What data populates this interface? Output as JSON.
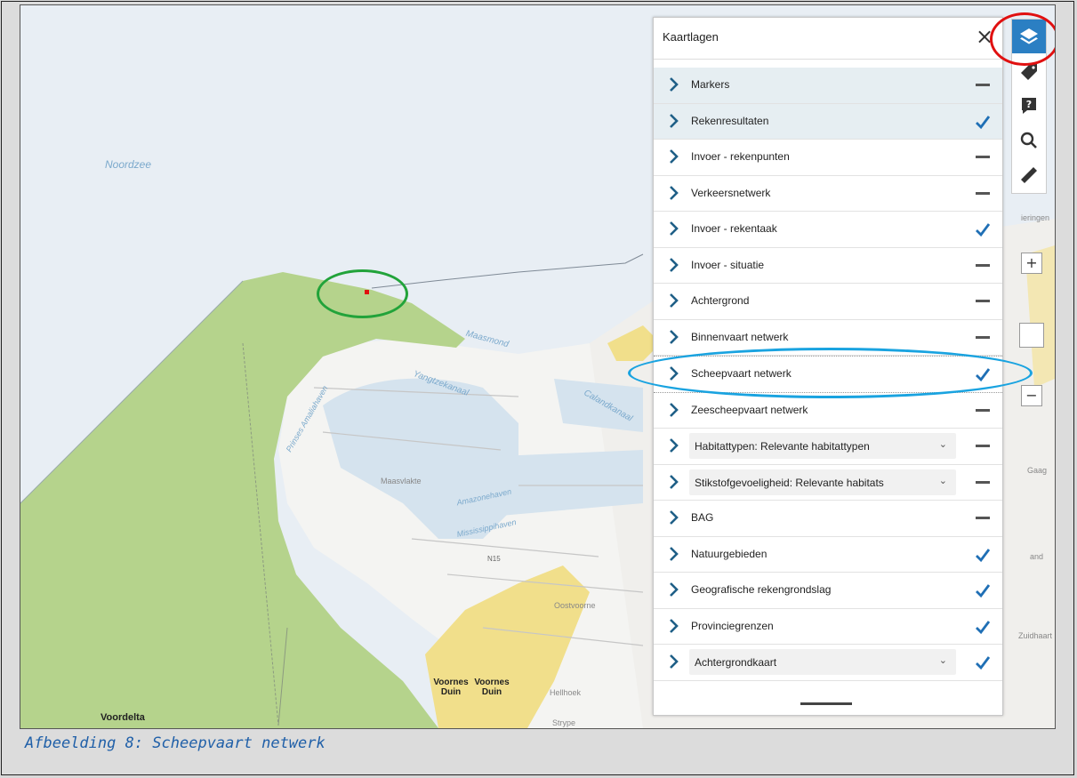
{
  "caption": "Afbeelding 8: Scheepvaart netwerk",
  "map": {
    "labels": {
      "noordzee": "Noordzee",
      "maasmond": "Maasmond",
      "yangtzekanaal": "Yangtzekanaal",
      "calandkanaal": "Calandkanaal",
      "prinses_amaliahaven": "Prinses Amaliahaven",
      "maasvlakte": "Maasvlakte",
      "amazonehaven": "Amazonehaven",
      "mississippihaven": "Mississippihaven",
      "n15": "N15",
      "oostvoorne": "Oostvoorne",
      "voornes_duin_1": "Voornes Duin",
      "voornes_duin_2": "Voornes Duin",
      "hellhoek": "Hellhoek",
      "voordelta": "Voordelta",
      "vierlingen": "ieringen",
      "gaag": "Gaag",
      "and": "and",
      "zuidhaert": "Zuidhaart",
      "strype": "Strype"
    }
  },
  "panel": {
    "title": "Kaartlagen",
    "close_symbol": "×",
    "layers": [
      {
        "label": "Markers",
        "state": "dash",
        "highlight": true,
        "dropdown": false
      },
      {
        "label": "Rekenresultaten",
        "state": "check",
        "highlight": true,
        "dropdown": false
      },
      {
        "label": "Invoer - rekenpunten",
        "state": "dash",
        "highlight": false,
        "dropdown": false
      },
      {
        "label": "Verkeersnetwerk",
        "state": "dash",
        "highlight": false,
        "dropdown": false
      },
      {
        "label": "Invoer - rekentaak",
        "state": "check",
        "highlight": false,
        "dropdown": false
      },
      {
        "label": "Invoer - situatie",
        "state": "dash",
        "highlight": false,
        "dropdown": false
      },
      {
        "label": "Achtergrond",
        "state": "dash",
        "highlight": false,
        "dropdown": false
      },
      {
        "label": "Binnenvaart netwerk",
        "state": "dash",
        "highlight": false,
        "dropdown": false
      },
      {
        "label": "Scheepvaart netwerk",
        "state": "check",
        "highlight": false,
        "dropdown": false
      },
      {
        "label": "Zeescheepvaart netwerk",
        "state": "dash",
        "highlight": false,
        "dropdown": false
      },
      {
        "label": "Habitattypen: Relevante habitattypen",
        "state": "dash",
        "highlight": false,
        "dropdown": true
      },
      {
        "label": "Stikstofgevoeligheid: Relevante habitats",
        "state": "dash",
        "highlight": false,
        "dropdown": true
      },
      {
        "label": "BAG",
        "state": "dash",
        "highlight": false,
        "dropdown": false
      },
      {
        "label": "Natuurgebieden",
        "state": "check",
        "highlight": false,
        "dropdown": false
      },
      {
        "label": "Geografische rekengrondslag",
        "state": "check",
        "highlight": false,
        "dropdown": false
      },
      {
        "label": "Provinciegrenzen",
        "state": "check",
        "highlight": false,
        "dropdown": false
      },
      {
        "label": "Achtergrondkaart",
        "state": "check",
        "highlight": false,
        "dropdown": true
      }
    ]
  },
  "toolbar": {
    "tools": [
      "layers-icon",
      "tag-icon",
      "info-icon",
      "search-icon",
      "ruler-icon"
    ]
  },
  "zoom": {
    "plus": "+",
    "minus": "−"
  },
  "colors": {
    "accent": "#2b7fc3",
    "chevron": "#1f5f87",
    "check": "#1f6fb5",
    "sea": "#e8eef4",
    "green_area": "#b5d38c",
    "sand_area": "#f1df8b",
    "red_annotation": "#e01010",
    "green_annotation": "#22a33a",
    "blue_annotation": "#19a3e0",
    "caption": "#1f5fa8"
  }
}
